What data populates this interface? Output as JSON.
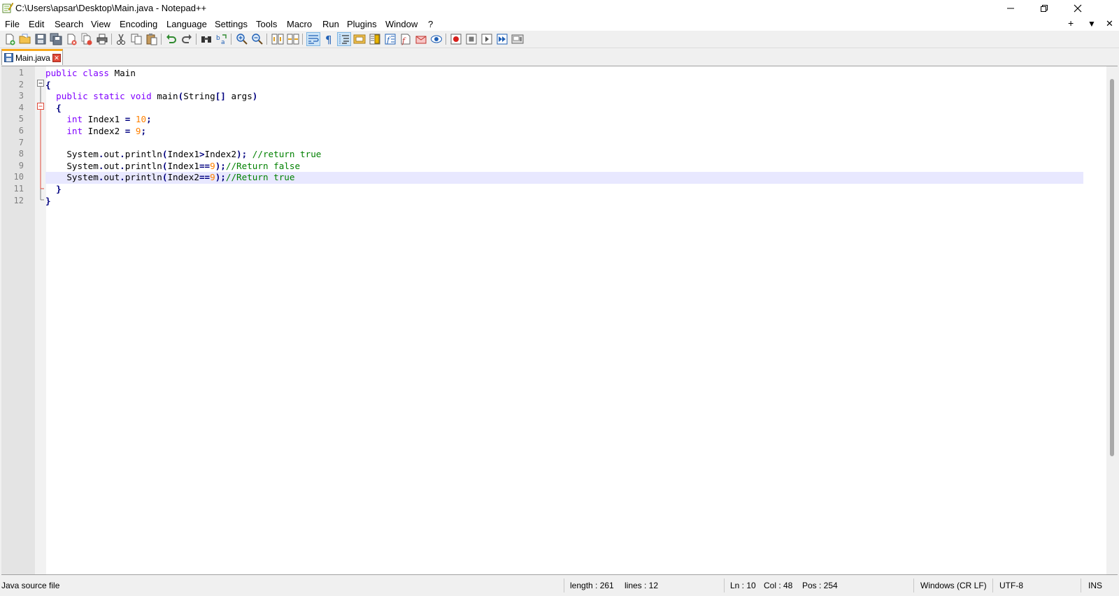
{
  "window": {
    "title": "C:\\Users\\apsar\\Desktop\\Main.java - Notepad++",
    "minimize_glyph": "—",
    "restore_glyph": "❐",
    "close_glyph": "✕"
  },
  "menubar": {
    "items": [
      "File",
      "Edit",
      "Search",
      "View",
      "Encoding",
      "Language",
      "Settings",
      "Tools",
      "Macro",
      "Run",
      "Plugins",
      "Window",
      "?"
    ],
    "right_controls": [
      "+",
      "▼",
      "✕"
    ]
  },
  "toolbar": {
    "icons": [
      "new-file-icon",
      "open-file-icon",
      "save-icon",
      "save-all-icon",
      "close-icon",
      "close-all-icon",
      "print-icon",
      "cut-icon",
      "copy-icon",
      "paste-icon",
      "undo-icon",
      "redo-icon",
      "find-icon",
      "replace-icon",
      "zoom-in-icon",
      "zoom-out-icon",
      "sync-vertical-icon",
      "sync-horizontal-icon",
      "word-wrap-icon",
      "show-all-chars-icon",
      "indent-guide-icon",
      "user-define-language-icon",
      "document-map-icon",
      "function-list-icon",
      "folder-as-workspace-icon",
      "clipboard-history-icon",
      "monitoring-icon",
      "record-macro-icon",
      "stop-macro-icon",
      "play-macro-icon",
      "run-macro-multiple-icon",
      "save-macro-icon"
    ]
  },
  "tabs": [
    {
      "label": "Main.java",
      "close_glyph": "✕"
    }
  ],
  "editor": {
    "line_numbers": [
      "1",
      "2",
      "3",
      "4",
      "5",
      "6",
      "7",
      "8",
      "9",
      "10",
      "11",
      "12"
    ],
    "current_line": 10,
    "lines": [
      [
        {
          "t": "public ",
          "c": "kw"
        },
        {
          "t": "class ",
          "c": "kw"
        },
        {
          "t": "Main",
          "c": "plain"
        }
      ],
      [
        {
          "t": "{",
          "c": "br"
        }
      ],
      [
        {
          "t": "  public ",
          "c": "kw"
        },
        {
          "t": "static ",
          "c": "kw"
        },
        {
          "t": "void ",
          "c": "ty"
        },
        {
          "t": "main",
          "c": "plain"
        },
        {
          "t": "(",
          "c": "br"
        },
        {
          "t": "String",
          "c": "plain"
        },
        {
          "t": "[]",
          "c": "br"
        },
        {
          "t": " args",
          "c": "plain"
        },
        {
          "t": ")",
          "c": "br"
        }
      ],
      [
        {
          "t": "  {",
          "c": "br"
        }
      ],
      [
        {
          "t": "    int ",
          "c": "ty"
        },
        {
          "t": "Index1 ",
          "c": "plain"
        },
        {
          "t": "= ",
          "c": "op"
        },
        {
          "t": "10",
          "c": "num"
        },
        {
          "t": ";",
          "c": "op"
        }
      ],
      [
        {
          "t": "    int ",
          "c": "ty"
        },
        {
          "t": "Index2 ",
          "c": "plain"
        },
        {
          "t": "= ",
          "c": "op"
        },
        {
          "t": "9",
          "c": "num"
        },
        {
          "t": ";",
          "c": "op"
        }
      ],
      [
        {
          "t": "",
          "c": "plain"
        }
      ],
      [
        {
          "t": "    System",
          "c": "plain"
        },
        {
          "t": ".",
          "c": "op"
        },
        {
          "t": "out",
          "c": "plain"
        },
        {
          "t": ".",
          "c": "op"
        },
        {
          "t": "println",
          "c": "plain"
        },
        {
          "t": "(",
          "c": "br"
        },
        {
          "t": "Index1",
          "c": "plain"
        },
        {
          "t": ">",
          "c": "op"
        },
        {
          "t": "Index2",
          "c": "plain"
        },
        {
          "t": ")",
          "c": "br"
        },
        {
          "t": "; ",
          "c": "op"
        },
        {
          "t": "//return true",
          "c": "cm"
        }
      ],
      [
        {
          "t": "    System",
          "c": "plain"
        },
        {
          "t": ".",
          "c": "op"
        },
        {
          "t": "out",
          "c": "plain"
        },
        {
          "t": ".",
          "c": "op"
        },
        {
          "t": "println",
          "c": "plain"
        },
        {
          "t": "(",
          "c": "br"
        },
        {
          "t": "Index1",
          "c": "plain"
        },
        {
          "t": "==",
          "c": "op"
        },
        {
          "t": "9",
          "c": "num"
        },
        {
          "t": ")",
          "c": "br"
        },
        {
          "t": ";",
          "c": "op"
        },
        {
          "t": "//Return false",
          "c": "cm"
        }
      ],
      [
        {
          "t": "    System",
          "c": "plain"
        },
        {
          "t": ".",
          "c": "op"
        },
        {
          "t": "out",
          "c": "plain"
        },
        {
          "t": ".",
          "c": "op"
        },
        {
          "t": "println",
          "c": "plain"
        },
        {
          "t": "(",
          "c": "br"
        },
        {
          "t": "Index2",
          "c": "plain"
        },
        {
          "t": "==",
          "c": "op"
        },
        {
          "t": "9",
          "c": "num"
        },
        {
          "t": ")",
          "c": "br"
        },
        {
          "t": ";",
          "c": "op"
        },
        {
          "t": "//Return true",
          "c": "cm"
        }
      ],
      [
        {
          "t": "  }",
          "c": "br"
        }
      ],
      [
        {
          "t": "}",
          "c": "br"
        }
      ]
    ]
  },
  "statusbar": {
    "file_type": "Java source file",
    "length": "length : 261",
    "lines": "lines : 12",
    "ln": "Ln : 10",
    "col": "Col : 48",
    "pos": "Pos : 254",
    "eol": "Windows (CR LF)",
    "encoding": "UTF-8",
    "mode": "INS"
  },
  "colors": {
    "keyword": "#8000ff",
    "number": "#ff8000",
    "comment": "#008000",
    "operator": "#000080",
    "current_line": "#e8e8ff",
    "tab_accent": "#f7a81b"
  }
}
